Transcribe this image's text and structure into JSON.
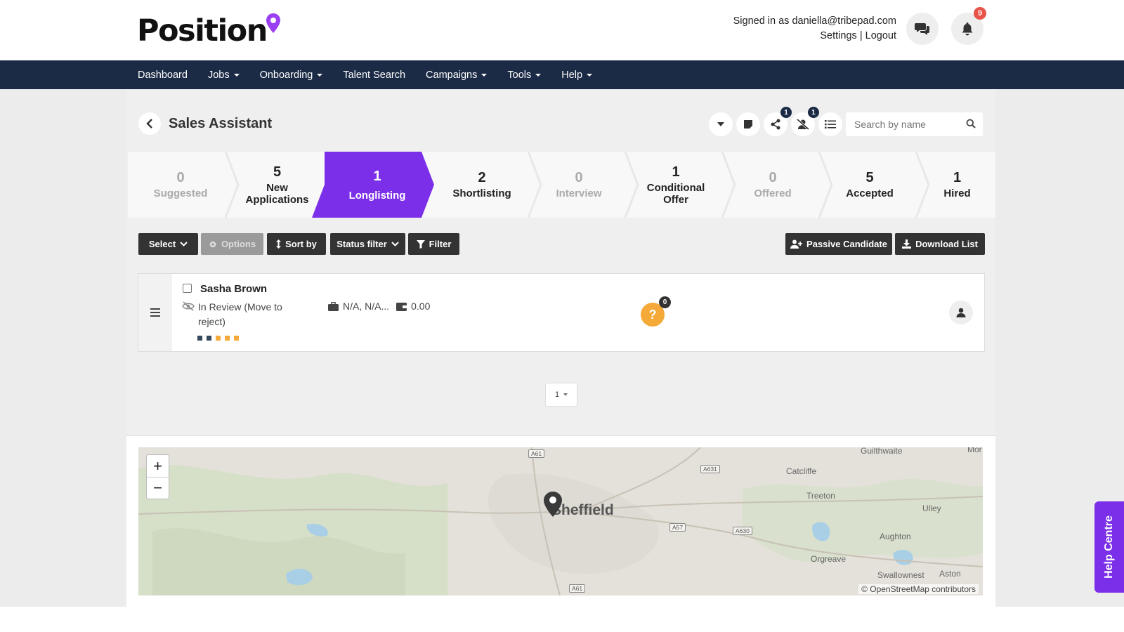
{
  "brand": {
    "logo_text": "Position",
    "accent": "#7b2fe8"
  },
  "header": {
    "signed_in": "Signed in as daniella@tribepad.com",
    "settings": "Settings",
    "separator": "|",
    "logout": "Logout",
    "notifications_count": "9"
  },
  "nav": {
    "items": [
      {
        "label": "Dashboard"
      },
      {
        "label": "Jobs"
      },
      {
        "label": "Onboarding"
      },
      {
        "label": "Talent Search"
      },
      {
        "label": "Campaigns"
      },
      {
        "label": "Tools"
      },
      {
        "label": "Help"
      }
    ]
  },
  "job": {
    "title": "Sales Assistant"
  },
  "toolbar": {
    "share_count": "1",
    "reject_count": "1",
    "search_placeholder": "Search by name"
  },
  "pipeline": [
    {
      "count": "0",
      "label": "Suggested"
    },
    {
      "count": "5",
      "label": "New Applications"
    },
    {
      "count": "1",
      "label": "Longlisting"
    },
    {
      "count": "2",
      "label": "Shortlisting"
    },
    {
      "count": "0",
      "label": "Interview"
    },
    {
      "count": "1",
      "label": "Conditional Offer"
    },
    {
      "count": "0",
      "label": "Offered"
    },
    {
      "count": "5",
      "label": "Accepted"
    },
    {
      "count": "1",
      "label": "Hired"
    }
  ],
  "actions": {
    "select": "Select",
    "options": "Options",
    "sort_by": "Sort by",
    "status_filter": "Status filter",
    "filter": "Filter",
    "passive_candidate": "Passive Candidate",
    "download_list": "Download List"
  },
  "candidate": {
    "name": "Sasha Brown",
    "status": "In Review (Move to reject)",
    "location": "N/A, N/A...",
    "score": "0.00",
    "questions_badge": "0",
    "question_mark": "?",
    "dot_colors": [
      "#34495e",
      "#34495e",
      "#f4a938",
      "#f4a938",
      "#f4a938"
    ]
  },
  "pagination": {
    "page": "1"
  },
  "map": {
    "city": "Sheffield",
    "places": [
      "Guilthwaite",
      "Catcliffe",
      "Treeton",
      "Ulley",
      "Aughton",
      "Orgreave",
      "Swallownest",
      "Aston",
      "Mor"
    ],
    "roads": [
      "A61",
      "A631",
      "A57",
      "A630",
      "A61"
    ],
    "attribution": "© OpenStreetMap contributors"
  },
  "help_centre": "Help Centre"
}
